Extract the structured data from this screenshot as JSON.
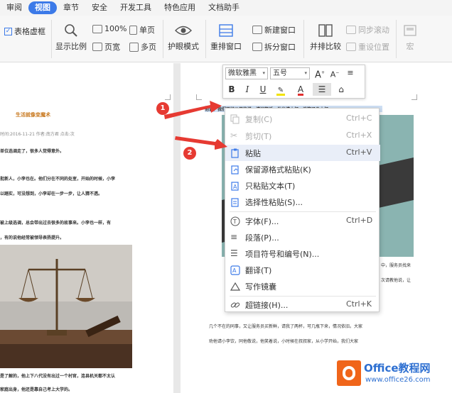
{
  "menu": {
    "tabs": [
      "审阅",
      "视图",
      "章节",
      "安全",
      "开发工具",
      "特色应用",
      "文档助手"
    ],
    "active": "视图"
  },
  "ribbon": {
    "gridlines": "表格虚框",
    "display_scale": "显示比例",
    "zoom_100": "100%",
    "page_width": "页宽",
    "single_page": "单页",
    "multi_page": "多页",
    "eye_mode": "护眼模式",
    "rearrange": "重排窗口",
    "new_window": "新建窗口",
    "split_window": "拆分窗口",
    "side_by_side": "并排比较",
    "sync_scroll": "同步滚动",
    "reset_position": "重设位置",
    "macro": "宏"
  },
  "left_page": {
    "title": "生活就像变魔术",
    "meta": "时间:2016-11-21 作者:南方君 点击:次",
    "lines": [
      "单位选调走了，很多人觉得意外。",
      "批新人，小李也在。他们分在不同的处室，开始的时候，小李",
      "以踏实，可没想到，小李却在一步一步，让人猜不透。",
      "被上级选调，总会带出过去很多的故事来。小李也一样，有",
      "，有的说他经常被领导表扬提升。"
    ],
    "bottom_lines": [
      "是了解的，他上下八代没有出过一个村官，连县机关都不太认",
      "家庭出身，他还是靠自己考上大学的。"
    ]
  },
  "right_page": {
    "selected_line": "他说，我们不妨公平的说，请问笑话，他也请小杯，谈笑了几小杯。",
    "side_line1": "中，服务员找来",
    "side_line2": "次请教他说，让",
    "body_lines": [
      "几个不在的同事，又让服务员买新鲜，请我了两杯，可几瓶下来，情况依旧。大家",
      "劝他请小李饮，同他敬说，他笑着说，小时候在叔叔家，从小学开始，我们大家"
    ]
  },
  "mini_toolbar": {
    "font": "微软雅黑",
    "size": "五号",
    "grow": "A",
    "shrink": "A",
    "bold": "B",
    "italic": "I",
    "underline": "U",
    "font_color": "A"
  },
  "context_menu": {
    "items": [
      {
        "label": "复制(C)",
        "shortcut": "Ctrl+C",
        "disabled": true
      },
      {
        "label": "剪切(T)",
        "shortcut": "Ctrl+X",
        "disabled": true
      },
      {
        "label": "粘贴",
        "shortcut": "Ctrl+V",
        "disabled": false
      },
      {
        "label": "保留源格式粘贴(K)",
        "shortcut": "",
        "disabled": false
      },
      {
        "label": "只粘贴文本(T)",
        "shortcut": "",
        "disabled": false
      },
      {
        "label": "选择性粘贴(S)...",
        "shortcut": "",
        "disabled": false
      },
      {
        "label": "字体(F)...",
        "shortcut": "Ctrl+D",
        "disabled": false
      },
      {
        "label": "段落(P)...",
        "shortcut": "",
        "disabled": false
      },
      {
        "label": "项目符号和编号(N)...",
        "shortcut": "",
        "disabled": false
      },
      {
        "label": "翻译(T)",
        "shortcut": "",
        "disabled": false
      },
      {
        "label": "写作镜囊",
        "shortcut": "",
        "disabled": false
      },
      {
        "label": "超链接(H)...",
        "shortcut": "Ctrl+K",
        "disabled": false
      }
    ]
  },
  "callouts": {
    "one": "1",
    "two": "2"
  },
  "watermark": {
    "brand": "Office教程网",
    "url": "www.office26.com"
  },
  "colors": {
    "accent": "#3c7ae8",
    "callout": "#e63a32",
    "teal": "#8ab4b1",
    "dark_band": "#3a3a3a",
    "title_orange": "#c8781e",
    "logo_orange": "#f0651a"
  }
}
